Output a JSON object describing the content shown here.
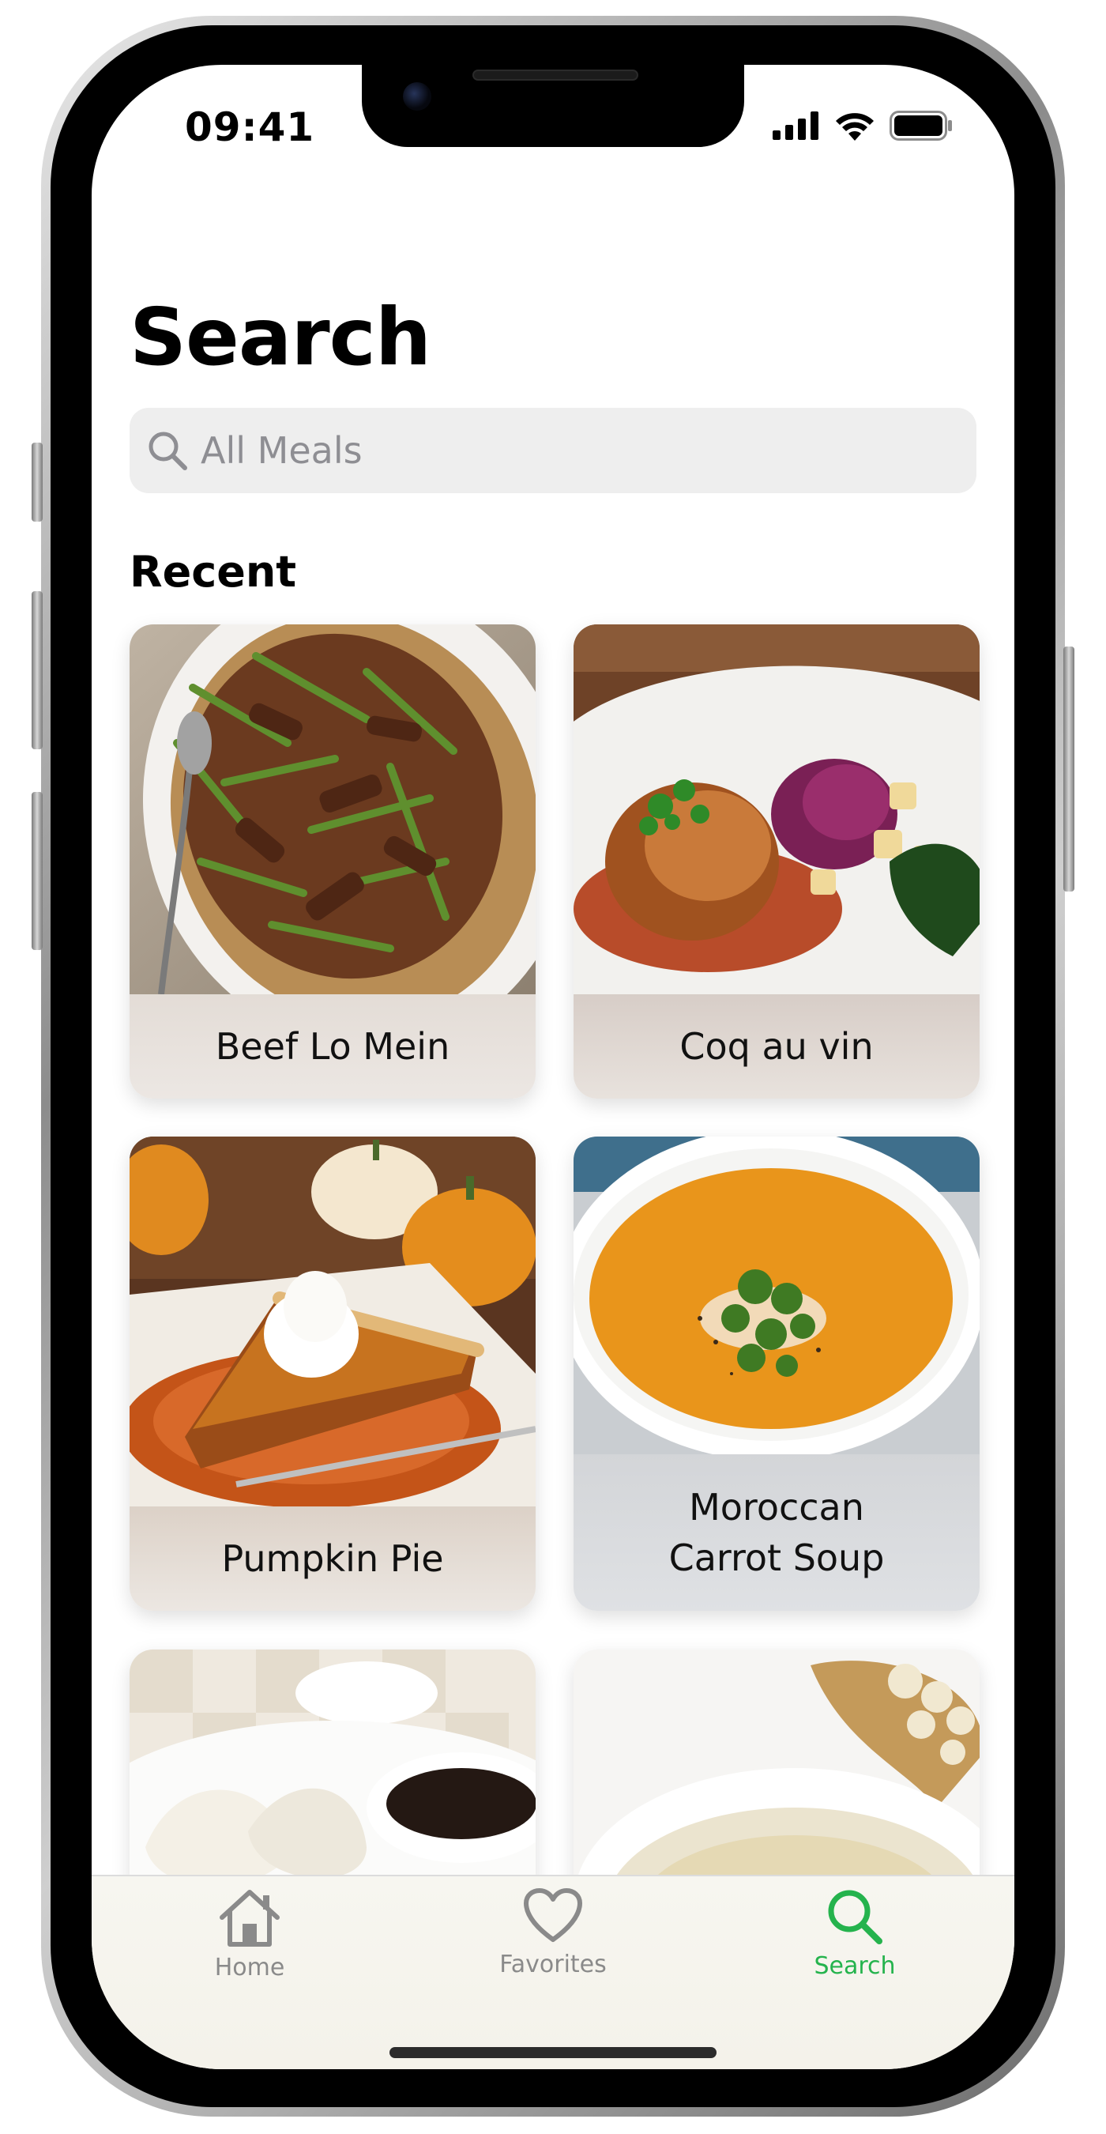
{
  "status_bar": {
    "time": "09:41",
    "icons": [
      "cellular-signal-icon",
      "wifi-icon",
      "battery-icon"
    ]
  },
  "header": {
    "title": "Search"
  },
  "search": {
    "placeholder": "All Meals",
    "icon": "magnifier-icon"
  },
  "section": {
    "title": "Recent"
  },
  "meals": [
    {
      "name": "Beef Lo Mein"
    },
    {
      "name": "Coq au vin"
    },
    {
      "name": "Pumpkin Pie"
    },
    {
      "name_line1": "Moroccan",
      "name_line2": "Carrot Soup"
    },
    {
      "name": ""
    },
    {
      "name": ""
    }
  ],
  "tabbar": {
    "items": [
      {
        "label": "Home",
        "icon": "house-icon",
        "active": false
      },
      {
        "label": "Favorites",
        "icon": "heart-icon",
        "active": false
      },
      {
        "label": "Search",
        "icon": "magnifier-icon",
        "active": true
      }
    ]
  },
  "colors": {
    "accent": "#25b34d",
    "inactive_tab": "#8a8a8a",
    "search_field_bg": "#eeeeee"
  }
}
